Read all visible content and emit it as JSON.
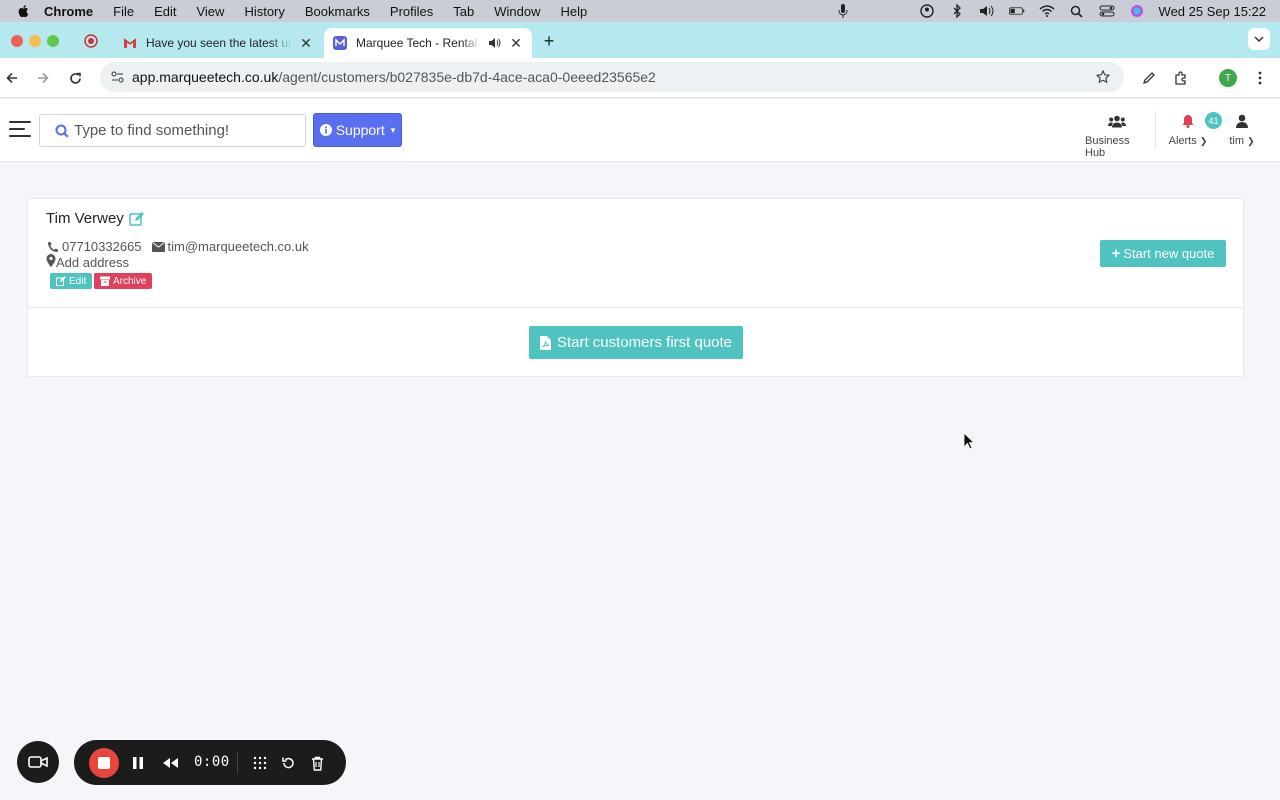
{
  "menubar": {
    "app_name": "Chrome",
    "items": [
      "File",
      "Edit",
      "View",
      "History",
      "Bookmarks",
      "Profiles",
      "Tab",
      "Window",
      "Help"
    ],
    "clock": "Wed 25 Sep  15:22"
  },
  "tabs": {
    "tab1_title": "Have you seen the latest upd",
    "tab2_title": "Marquee Tech - Rental So",
    "new_tab": "+"
  },
  "address_bar": {
    "host": "app.marqueetech.co.uk",
    "path": "/agent/customers/b027835e-db7d-4ace-aca0-0eeed23565e2",
    "profile_initial": "T"
  },
  "header": {
    "search_placeholder": "Type to find something!",
    "support_label": "Support",
    "business_hub_label": "Business Hub",
    "alerts_label": "Alerts",
    "alerts_count": "41",
    "user_label": "tim"
  },
  "customer": {
    "name": "Tim Verwey",
    "phone": "07710332665",
    "email": "tim@marqueetech.co.uk",
    "address_label": "Add address",
    "edit_label": "Edit",
    "archive_label": "Archive",
    "start_new_quote_label": "Start new quote",
    "first_quote_label": "Start customers first quote"
  },
  "recorder": {
    "time": "0:00"
  },
  "colors": {
    "accent_teal": "#4fc3c0",
    "danger_red": "#e0405a",
    "support_blue": "#5a6ff0",
    "tabstrip": "#b6e8f0"
  }
}
